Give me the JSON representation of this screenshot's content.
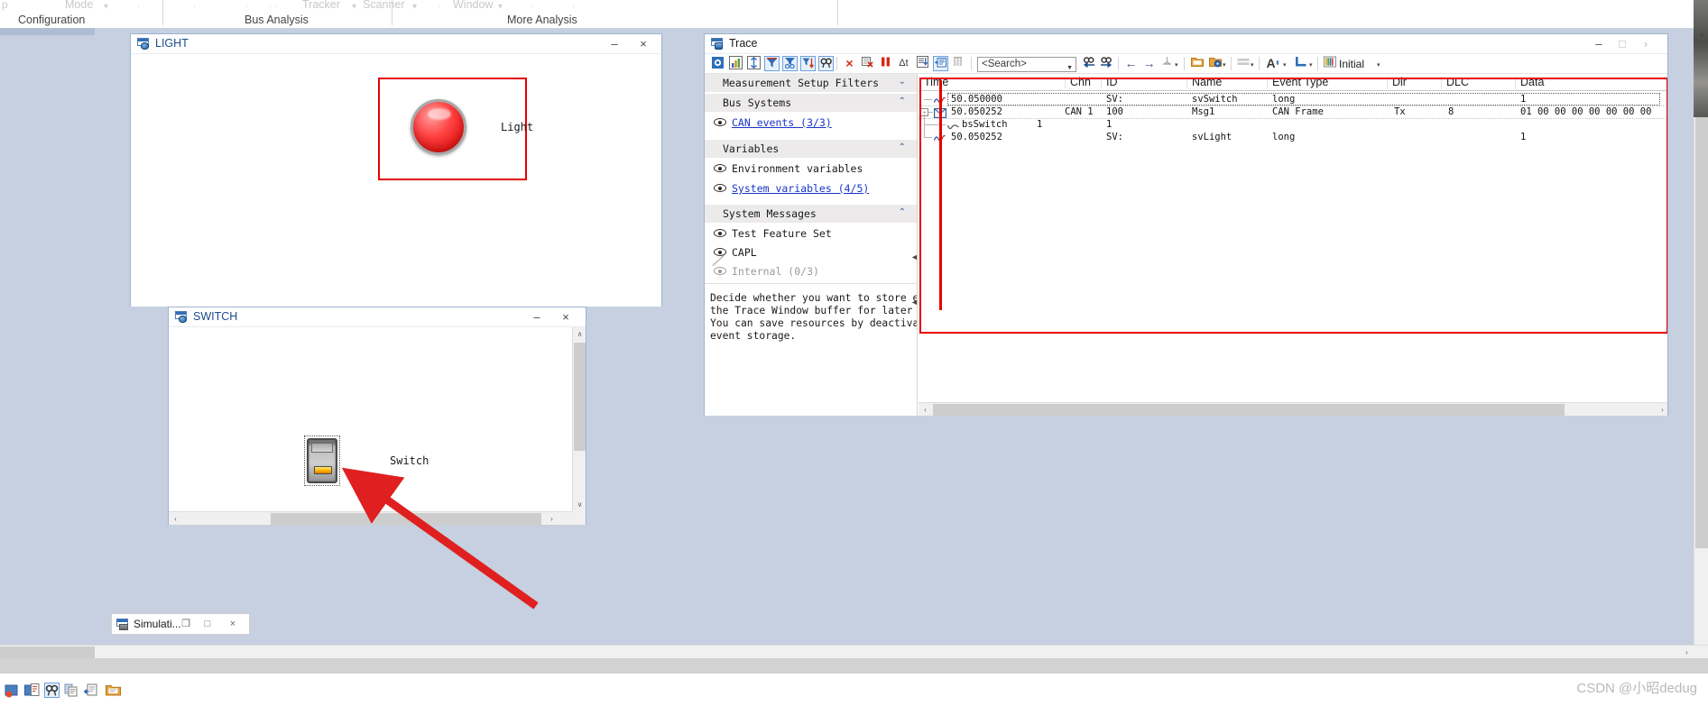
{
  "ribbon": {
    "groups": [
      {
        "caption": "Configuration",
        "items": [
          "Mode"
        ]
      },
      {
        "caption": "Bus Analysis",
        "items": [
          "Tracker",
          "Scanner"
        ]
      },
      {
        "caption": "More Analysis",
        "items": [
          "Window"
        ]
      }
    ]
  },
  "light_window": {
    "title": "LIGHT",
    "icon": "vector-panel-icon",
    "minimize": "–",
    "close": "×",
    "indicator_label": "Light",
    "indicator_state": "on",
    "indicator_color": "#ff4242"
  },
  "switch_window": {
    "title": "SWITCH",
    "icon": "vector-panel-icon",
    "minimize": "–",
    "close": "×",
    "control_label": "Switch",
    "led_color": "#ffb300",
    "scroll_up": "∧",
    "scroll_down": "∨",
    "scroll_left": "‹",
    "scroll_right": "›"
  },
  "trace_window": {
    "title": "Trace",
    "icon": "trace-window-icon",
    "minimize": "–",
    "maximize": "□",
    "close": "›",
    "search": {
      "placeholder": "<Search>",
      "value": ""
    },
    "toolbar_left": [
      {
        "name": "measurement-setup-icon",
        "glyph": "▣",
        "framed": false
      },
      {
        "name": "statistics-icon",
        "glyph": "Ὄa",
        "framed": false
      },
      {
        "name": "expand-all-icon",
        "glyph": "≣",
        "framed": false
      },
      {
        "name": "filter-icon",
        "glyph": "▼",
        "framed": true
      },
      {
        "name": "filter-group-icon",
        "glyph": "▼▼",
        "framed": true
      },
      {
        "name": "sort-filter-icon",
        "glyph": "▼↓",
        "framed": true
      },
      {
        "name": "find-icon",
        "glyph": "ὐe",
        "framed": true
      },
      {
        "name": "clear-icon",
        "glyph": "×",
        "framed": false
      },
      {
        "name": "clear-window-icon",
        "glyph": "⊟",
        "framed": false
      },
      {
        "name": "pause-icon",
        "glyph": "‖",
        "framed": false
      },
      {
        "name": "delta-time-icon",
        "glyph": "Δt",
        "framed": false
      },
      {
        "name": "scroll-to-end-icon",
        "glyph": "↓",
        "framed": false
      },
      {
        "name": "store-events-icon",
        "glyph": "≡",
        "framed": true
      },
      {
        "name": "column-config-icon",
        "glyph": "❙❙",
        "framed": false
      }
    ],
    "toolbar_right": [
      {
        "name": "find-previous-icon",
        "glyph": "←"
      },
      {
        "name": "find-next-icon",
        "glyph": "→"
      },
      {
        "name": "navigate-back-icon",
        "glyph": "←"
      },
      {
        "name": "navigate-forward-icon",
        "glyph": "→"
      },
      {
        "name": "marker-icon",
        "glyph": "↧"
      },
      {
        "name": "open-folder-icon",
        "glyph": "▤"
      },
      {
        "name": "logging-config-icon",
        "glyph": "▥"
      },
      {
        "name": "row-layout-icon",
        "glyph": "≣"
      },
      {
        "name": "font-size-icon",
        "glyph": "A"
      },
      {
        "name": "color-config-icon",
        "glyph": "┗"
      },
      {
        "name": "profile-icon",
        "glyph": "▐▐"
      }
    ],
    "profile_label": "Initial",
    "filter_pane": {
      "sections": [
        {
          "type": "header",
          "name": "measurement-setup-filters",
          "label": "Measurement Setup Filters",
          "chevron": "⌄"
        },
        {
          "type": "header",
          "name": "bus-systems",
          "label": "Bus Systems",
          "chevron": "⌃"
        },
        {
          "type": "row",
          "name": "can-events",
          "label": "CAN events (3/3)",
          "link": true,
          "eye": "visible"
        },
        {
          "type": "header",
          "name": "variables",
          "label": "Variables",
          "chevron": "⌃"
        },
        {
          "type": "row",
          "name": "environment-variables",
          "label": "Environment variables",
          "link": false,
          "eye": "visible"
        },
        {
          "type": "row",
          "name": "system-variables",
          "label": "System variables (4/5)",
          "link": true,
          "eye": "visible"
        },
        {
          "type": "header",
          "name": "system-messages",
          "label": "System Messages",
          "chevron": "⌃"
        },
        {
          "type": "row",
          "name": "test-feature-set",
          "label": "Test Feature Set",
          "link": false,
          "eye": "visible"
        },
        {
          "type": "row",
          "name": "capl",
          "label": "CAPL",
          "link": false,
          "eye": "visible"
        },
        {
          "type": "row",
          "name": "internal",
          "label": "Internal (0/3)",
          "link": false,
          "dim": true,
          "eye": "hidden"
        }
      ],
      "description": "Decide whether you want to store events in\nthe Trace Window buffer for later analysis\nYou can save resources by deactivating\nevent storage."
    },
    "grid": {
      "columns": [
        "Time",
        "Chn",
        "ID",
        "Name",
        "Event Type",
        "Dir",
        "DLC",
        "Data"
      ],
      "rows": [
        {
          "icon": "system-variable-icon",
          "indent": 1,
          "selected": true,
          "expandable": false,
          "time": "50.050000",
          "chn": "",
          "id": "SV:",
          "name": "svSwitch",
          "event_type": "long",
          "dir": "",
          "dlc": "",
          "data": "1"
        },
        {
          "icon": "can-frame-icon",
          "indent": 1,
          "selected": false,
          "expandable": true,
          "expander": "-",
          "time": "50.050252",
          "chn": "CAN 1",
          "id": "100",
          "name": "Msg1",
          "event_type": "CAN Frame",
          "dir": "Tx",
          "dlc": "8",
          "data": "01 00 00 00 00 00 00 00"
        },
        {
          "icon": "signal-icon",
          "indent": 2,
          "selected": false,
          "expandable": false,
          "time": "",
          "chn": "",
          "id": "",
          "name": "",
          "event_type": "",
          "dir": "",
          "dlc": "",
          "data": "",
          "signal_name": "bsSwitch",
          "signal_chn": "1",
          "signal_value": "1"
        },
        {
          "icon": "system-variable-icon",
          "indent": 1,
          "selected": false,
          "expandable": false,
          "time": "50.050252",
          "chn": "",
          "id": "SV:",
          "name": "svLight",
          "event_type": "long",
          "dir": "",
          "dlc": "",
          "data": "1"
        }
      ]
    },
    "scroll_left": "‹",
    "scroll_right": "›"
  },
  "taskbar": {
    "button": {
      "icon": "simulation-setup-icon",
      "label": "Simulati...",
      "restore": "❐",
      "maximize": "□",
      "close": "×"
    }
  },
  "statusbar": {
    "icons": [
      "measurement-start-icon",
      "config-icon",
      "find-icon",
      "copy-icon",
      "export-icon",
      "folder-icon"
    ]
  },
  "app_scroll": {
    "up": "∧",
    "down": "∨",
    "left": "‹",
    "right": "›"
  },
  "watermark": "CSDN @小昭dedug",
  "accents": {
    "highlight_red": "#e60000",
    "link_blue": "#1a35c8",
    "title_blue": "#1c4b8b",
    "toolbar_frame": "#6aa0dc"
  }
}
